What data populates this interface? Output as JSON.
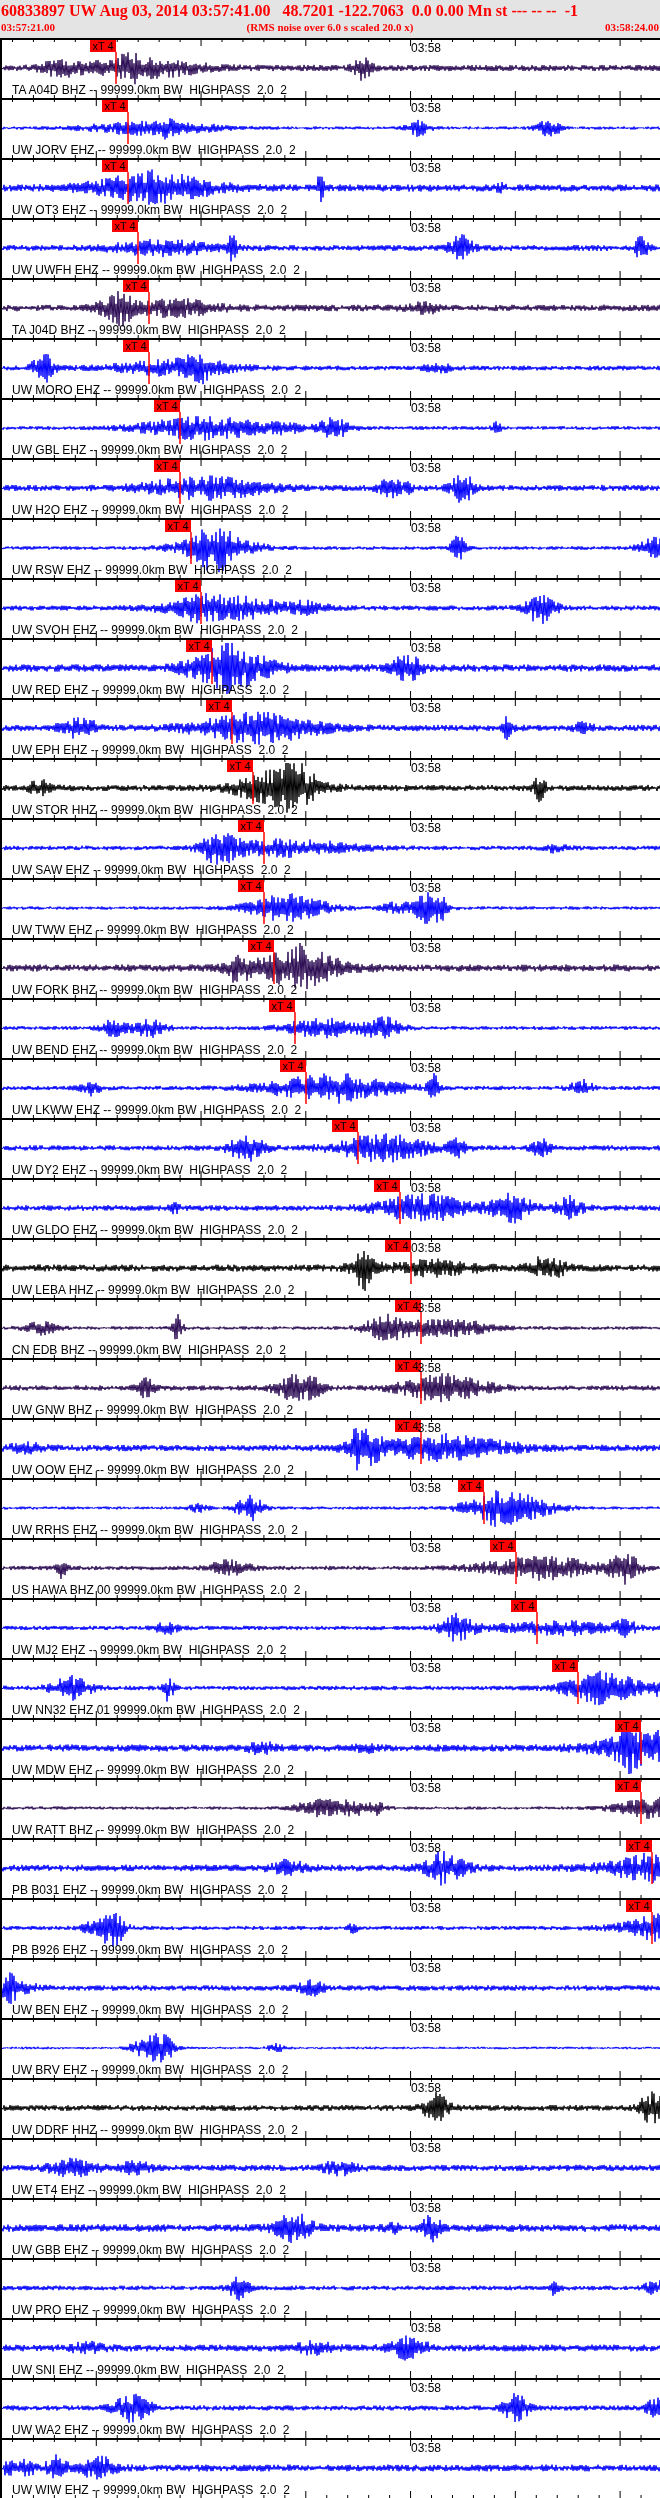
{
  "header": {
    "title": "60833897 UW Aug 03, 2014 03:57:41.00   48.7201 -122.7063  0.0 0.00 Mn st --- -- --  -1",
    "start_time": "03:57:21.00",
    "note": "(RMS noise over 6.0 s scaled 20.0 x)",
    "end_time": "03:58:24.00"
  },
  "traces": [
    {
      "label": "TA A04D BHZ -- 99999.0km BW  HIGHPASS  2.0  2",
      "time_label": "03:58",
      "color": "#2a0a52",
      "pick": {
        "label": "xT 4"
      }
    },
    {
      "label": "UW JORV EHZ -- 99999.0km BW  HIGHPASS  2.0  2",
      "time_label": "03:58",
      "color": "#0000ff",
      "pick": {
        "label": "xT 4"
      }
    },
    {
      "label": "UW OT3 EHZ -- 99999.0km BW  HIGHPASS  2.0  2",
      "time_label": "03:58",
      "color": "#0000ff",
      "pick": {
        "label": "xT 4"
      }
    },
    {
      "label": "UW UWFH EHZ -- 99999.0km BW  HIGHPASS  2.0  2",
      "time_label": "03:58",
      "color": "#0000ff",
      "pick": {
        "label": "xT 4"
      }
    },
    {
      "label": "TA J04D BHZ -- 99999.0km BW  HIGHPASS  2.0  2",
      "time_label": "03:58",
      "color": "#2a0a52",
      "pick": {
        "label": "xT 4"
      }
    },
    {
      "label": "UW MORO EHZ -- 99999.0km BW  HIGHPASS  2.0  2",
      "time_label": "03:58",
      "color": "#0000ff",
      "pick": {
        "label": "xT 4"
      }
    },
    {
      "label": "UW GBL EHZ -- 99999.0km BW  HIGHPASS  2.0  2",
      "time_label": "03:58",
      "color": "#0000ff",
      "pick": {
        "label": "xT 4"
      }
    },
    {
      "label": "UW H2O EHZ -- 99999.0km BW  HIGHPASS  2.0  2",
      "time_label": "03:58",
      "color": "#0000ff",
      "pick": {
        "label": "xT 4"
      }
    },
    {
      "label": "UW RSW EHZ -- 99999.0km BW  HIGHPASS  2.0  2",
      "time_label": "03:58",
      "color": "#0000ff",
      "pick": {
        "label": "xT 4"
      }
    },
    {
      "label": "UW SVOH EHZ -- 99999.0km BW  HIGHPASS  2.0  2",
      "time_label": "03:58",
      "color": "#0000ff",
      "pick": {
        "label": "xT 4"
      }
    },
    {
      "label": "UW RED EHZ -- 99999.0km BW  HIGHPASS  2.0  2",
      "time_label": "03:58",
      "color": "#0000ff",
      "pick": {
        "label": "xT 4"
      }
    },
    {
      "label": "UW EPH EHZ -- 99999.0km BW  HIGHPASS  2.0  2",
      "time_label": "03:58",
      "color": "#0000ff",
      "pick": {
        "label": "xT 4"
      }
    },
    {
      "label": "UW STOR HHZ -- 99999.0km BW  HIGHPASS  2.0  2",
      "time_label": "03:58",
      "color": "#000000",
      "pick": {
        "label": "xT 4"
      }
    },
    {
      "label": "UW SAW EHZ -- 99999.0km BW  HIGHPASS  2.0  2",
      "time_label": "03:58",
      "color": "#0000ff",
      "pick": {
        "label": "xT 4"
      }
    },
    {
      "label": "UW TWW EHZ -- 99999.0km BW  HIGHPASS  2.0  2",
      "time_label": "03:58",
      "color": "#0000ff",
      "pick": {
        "label": "xT 4"
      }
    },
    {
      "label": "UW FORK BHZ -- 99999.0km BW  HIGHPASS  2.0  2",
      "time_label": "03:58",
      "color": "#2a0a52",
      "pick": {
        "label": "xT 4"
      }
    },
    {
      "label": "UW BEND EHZ -- 99999.0km BW  HIGHPASS  2.0  2",
      "time_label": "03:58",
      "color": "#0000ff",
      "pick": {
        "label": "xT 4"
      }
    },
    {
      "label": "UW LKWW EHZ -- 99999.0km BW  HIGHPASS  2.0  2",
      "time_label": "03:58",
      "color": "#0000ff",
      "pick": {
        "label": "xT 4"
      }
    },
    {
      "label": "UW DY2 EHZ -- 99999.0km BW  HIGHPASS  2.0  2",
      "time_label": "03:58",
      "color": "#0000ff",
      "pick": {
        "label": "xT 4"
      }
    },
    {
      "label": "UW GLDO EHZ -- 99999.0km BW  HIGHPASS  2.0  2",
      "time_label": "03:58",
      "color": "#0000ff",
      "pick": {
        "label": "xT 4"
      }
    },
    {
      "label": "UW LEBA HHZ -- 99999.0km BW  HIGHPASS  2.0  2",
      "time_label": "03:58",
      "color": "#000000",
      "pick": {
        "label": "xT 4"
      }
    },
    {
      "label": "CN EDB BHZ -- 99999.0km BW  HIGHPASS  2.0  2",
      "time_label": "3:58",
      "color": "#2a0a52",
      "pick": {
        "label": "xT 4"
      }
    },
    {
      "label": "UW GNW BHZ -- 99999.0km BW  HIGHPASS  2.0  2",
      "time_label": "3:58",
      "color": "#2a0a52",
      "pick": {
        "label": "xT 4"
      }
    },
    {
      "label": "UW OOW EHZ -- 99999.0km BW  HIGHPASS  2.0  2",
      "time_label": "3:58",
      "color": "#0000ff",
      "pick": {
        "label": "xT 4"
      }
    },
    {
      "label": "UW RRHS EHZ -- 99999.0km BW  HIGHPASS  2.0  2",
      "time_label": "03:58",
      "color": "#0000ff",
      "pick": {
        "label": "xT 4"
      }
    },
    {
      "label": "US HAWA BHZ 00 99999.0km BW  HIGHPASS  2.0  2",
      "time_label": "03:58",
      "color": "#2a0a52",
      "pick": {
        "label": "xT 4"
      }
    },
    {
      "label": "UW MJ2 EHZ -- 99999.0km BW  HIGHPASS  2.0  2",
      "time_label": "03:58",
      "color": "#0000ff",
      "pick": {
        "label": "xT 4"
      }
    },
    {
      "label": "UW NN32 EHZ 01 99999.0km BW  HIGHPASS  2.0  2",
      "time_label": "03:58",
      "color": "#0000ff",
      "pick": {
        "label": "xT 4"
      }
    },
    {
      "label": "UW MDW EHZ -- 99999.0km BW  HIGHPASS  2.0  2",
      "time_label": "03:58",
      "color": "#0000ff",
      "pick": {
        "label": "xT 4"
      }
    },
    {
      "label": "UW RATT BHZ -- 99999.0km BW  HIGHPASS  2.0  2",
      "time_label": "03:58",
      "color": "#2a0a52",
      "pick": {
        "label": "xT 4"
      }
    },
    {
      "label": "PB B031 EHZ -- 99999.0km BW  HIGHPASS  2.0  2",
      "time_label": "03:58",
      "color": "#0000ff",
      "pick": {
        "label": "xT 4"
      }
    },
    {
      "label": "PB B926 EHZ -- 99999.0km BW  HIGHPASS  2.0  2",
      "time_label": "03:58",
      "color": "#0000ff",
      "pick": {
        "label": "xT 4"
      }
    },
    {
      "label": "UW BEN EHZ -- 99999.0km BW  HIGHPASS  2.0  2",
      "time_label": "03:58",
      "color": "#0000ff"
    },
    {
      "label": "UW BRV EHZ -- 99999.0km BW  HIGHPASS  2.0  2",
      "time_label": "03:58",
      "color": "#0000ff"
    },
    {
      "label": "UW DDRF HHZ -- 99999.0km BW  HIGHPASS  2.0  2",
      "time_label": "03:58",
      "color": "#000000"
    },
    {
      "label": "UW ET4 EHZ -- 99999.0km BW  HIGHPASS  2.0  2",
      "time_label": "03:58",
      "color": "#0000ff"
    },
    {
      "label": "UW GBB EHZ -- 99999.0km BW  HIGHPASS  2.0  2",
      "time_label": "03:58",
      "color": "#0000ff"
    },
    {
      "label": "UW PRO EHZ -- 99999.0km BW  HIGHPASS  2.0  2",
      "time_label": "03:58",
      "color": "#0000ff"
    },
    {
      "label": "UW SNI EHZ -- 99999.0km BW  HIGHPASS  2.0  2",
      "time_label": "03:58",
      "color": "#0000ff"
    },
    {
      "label": "UW WA2 EHZ -- 99999.0km BW  HIGHPASS  2.0  2",
      "time_label": "03:58",
      "color": "#0000ff"
    },
    {
      "label": "UW WIW EHZ -- 99999.0km BW  HIGHPASS  2.0  2",
      "time_label": "03:58",
      "color": "#0000ff"
    }
  ]
}
